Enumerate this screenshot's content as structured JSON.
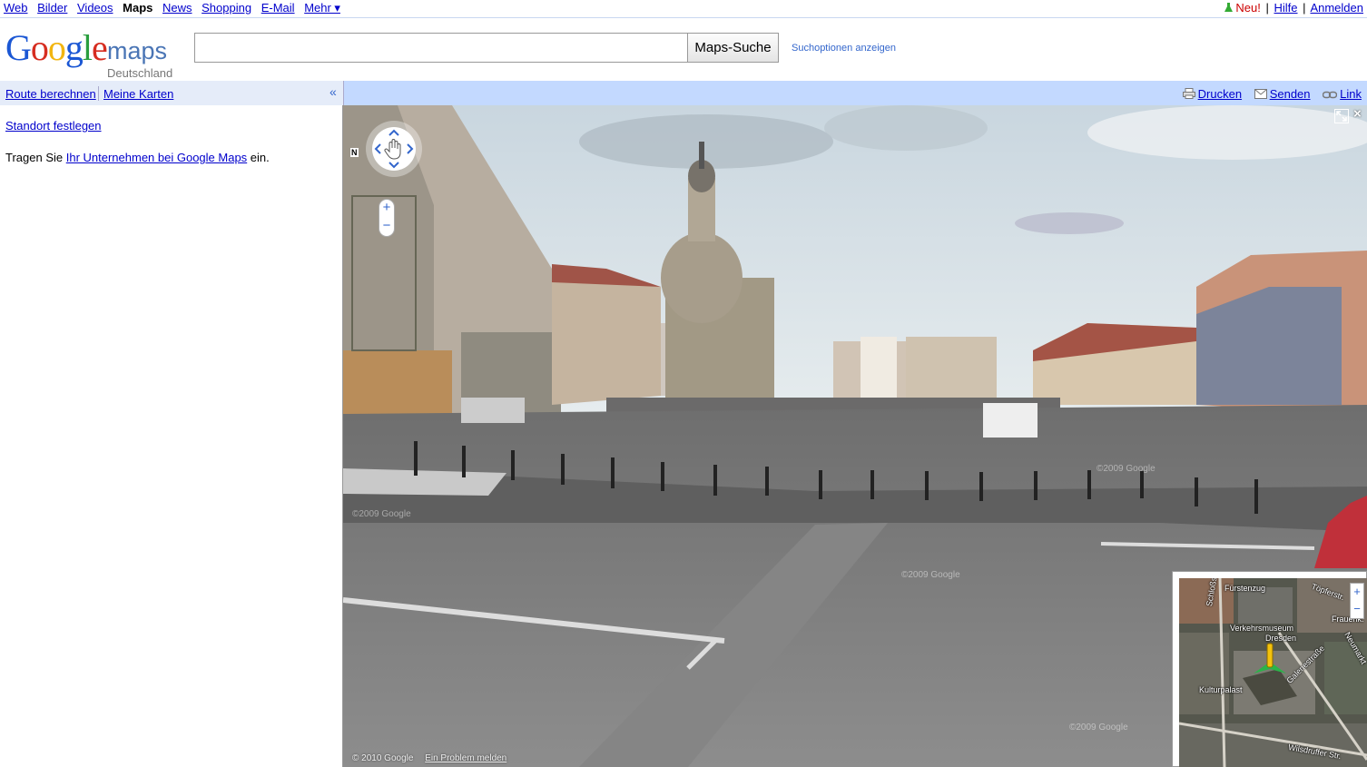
{
  "gbar": {
    "left_links": [
      "Web",
      "Bilder",
      "Videos",
      "Maps",
      "News",
      "Shopping",
      "E-Mail",
      "Mehr ▾"
    ],
    "current": "Maps",
    "neu": "Neu!",
    "help": "Hilfe",
    "login": "Anmelden",
    "separator": "|"
  },
  "header": {
    "logo_google": "Google",
    "logo_maps": "maps",
    "logo_country": "Deutschland",
    "search_value": "",
    "search_button": "Maps-Suche",
    "search_options": "Suchoptionen anzeigen"
  },
  "toolbar": {
    "route": "Route berechnen",
    "my_maps": "Meine Karten",
    "collapse": "«",
    "print": "Drucken",
    "send": "Senden",
    "link": "Link"
  },
  "panel": {
    "set_location": "Standort festlegen",
    "business_prefix": "Tragen Sie ",
    "business_link": "Ihr Unternehmen bei Google Maps",
    "business_suffix": " ein."
  },
  "streetview": {
    "compass_n": "N",
    "copyright": "© 2010 Google",
    "report": "Ein Problem melden",
    "watermark_1": "©2009 Google",
    "watermark_2": "©2009 Google",
    "watermark_3": "©2009 Google",
    "watermark_4": "©2009 Google",
    "close": "×",
    "zoom_in": "+",
    "zoom_out": "−"
  },
  "minimap": {
    "zoom_in": "+",
    "zoom_out": "−",
    "labels": [
      "Fürstenzug",
      "Töpferstr.",
      "Frauenk.",
      "Verkehrsmuseum",
      "Dresden",
      "Galeriestraße",
      "Schloßstraße",
      "Kulturpalast",
      "Wilsdruffer Str.",
      "Neumarkt"
    ]
  },
  "colors": {
    "link": "#0000cc",
    "toolbar_left": "#e5ecf9",
    "toolbar_right": "#c3d9ff",
    "neu": "#cc0000"
  }
}
